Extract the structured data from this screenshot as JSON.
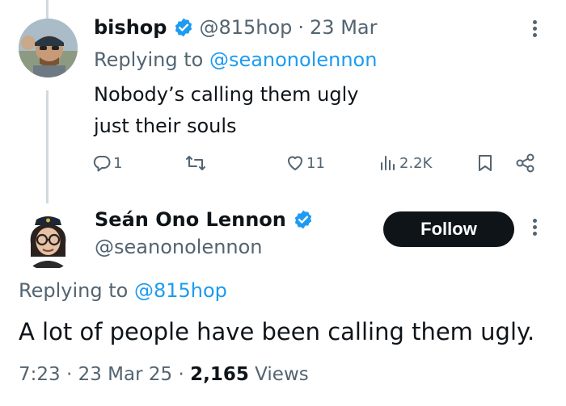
{
  "reply": {
    "name": "bishop",
    "handle": "@815hop",
    "separator": "·",
    "date": "23 Mar",
    "replying_prefix": "Replying to ",
    "replying_handle": "@seanonolennon",
    "text_line1": "Nobody’s calling them ugly",
    "text_line2": "just their souls",
    "actions": {
      "replies": "1",
      "retweets": "",
      "likes": "11",
      "views": "2.2K"
    }
  },
  "main": {
    "name": "Seán Ono Lennon",
    "handle": "@seanonolennon",
    "follow_label": "Follow",
    "replying_prefix": "Replying to ",
    "replying_handle": "@815hop",
    "text": "A lot of people have been calling them ugly.",
    "time": "7:23",
    "separator": "·",
    "date": "23 Mar 25",
    "views_count": "2,165",
    "views_label": "Views"
  },
  "colors": {
    "link": "#1d9bf0",
    "muted": "#536471",
    "text": "#0f1419",
    "thread_line": "#cfd9de"
  },
  "icons": [
    "verified-badge-icon",
    "more-icon",
    "reply-icon",
    "retweet-icon",
    "like-icon",
    "views-icon",
    "bookmark-icon",
    "share-icon"
  ]
}
